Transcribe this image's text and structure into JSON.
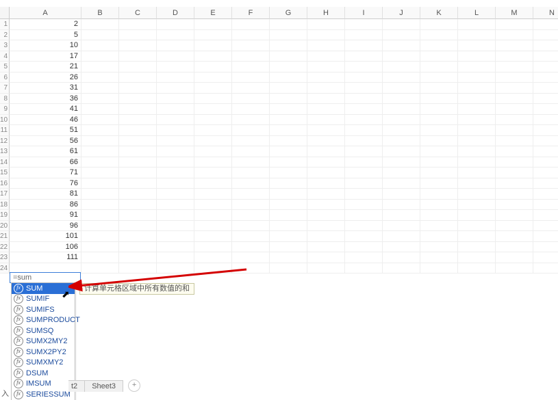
{
  "columns": [
    "A",
    "B",
    "C",
    "D",
    "E",
    "F",
    "G",
    "H",
    "I",
    "J",
    "K",
    "L",
    "M",
    "N"
  ],
  "column_a_values": [
    2,
    5,
    10,
    17,
    21,
    26,
    31,
    36,
    41,
    46,
    51,
    56,
    61,
    66,
    71,
    76,
    81,
    86,
    91,
    96,
    101,
    106,
    111
  ],
  "formula_input": "=sum",
  "suggestions": [
    {
      "name": "SUM",
      "selected": true
    },
    {
      "name": "SUMIF",
      "selected": false
    },
    {
      "name": "SUMIFS",
      "selected": false
    },
    {
      "name": "SUMPRODUCT",
      "selected": false
    },
    {
      "name": "SUMSQ",
      "selected": false
    },
    {
      "name": "SUMX2MY2",
      "selected": false
    },
    {
      "name": "SUMX2PY2",
      "selected": false
    },
    {
      "name": "SUMXMY2",
      "selected": false
    },
    {
      "name": "DSUM",
      "selected": false
    },
    {
      "name": "IMSUM",
      "selected": false
    },
    {
      "name": "SERIESSUM",
      "selected": false
    }
  ],
  "suggestion_icon_label": "fx",
  "tooltip_text": "计算单元格区域中所有数值的和",
  "sheet_tabs": {
    "partial": "t2",
    "full": "Sheet3"
  },
  "add_sheet_label": "+",
  "status_text": "入"
}
